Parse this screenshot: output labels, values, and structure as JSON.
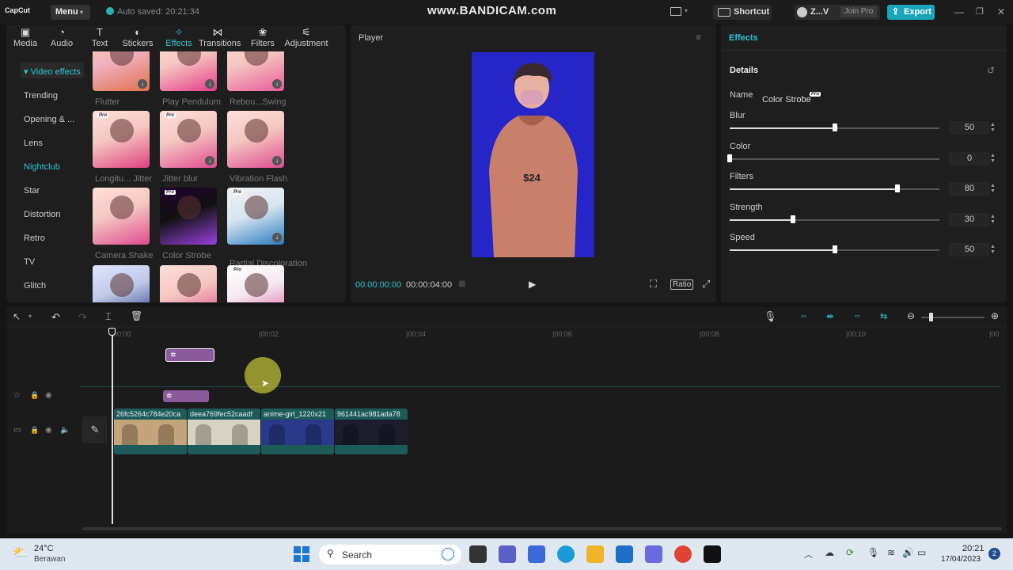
{
  "titlebar": {
    "app_name": "CapCut",
    "menu_label": "Menu",
    "autosave": "Auto saved: 20:21:34",
    "watermark": "www.BANDICAM.com",
    "shortcut_label": "Shortcut",
    "user_name": "Z...V",
    "join_pro": "Join Pro",
    "export_label": "Export"
  },
  "media_tabs": [
    {
      "label": "Media",
      "icon": "media-icon"
    },
    {
      "label": "Audio",
      "icon": "audio-icon"
    },
    {
      "label": "Text",
      "icon": "text-icon"
    },
    {
      "label": "Stickers",
      "icon": "stickers-icon"
    },
    {
      "label": "Effects",
      "icon": "effects-icon",
      "active": true
    },
    {
      "label": "Transitions",
      "icon": "transitions-icon"
    },
    {
      "label": "Filters",
      "icon": "filters-icon"
    },
    {
      "label": "Adjustment",
      "icon": "adjustment-icon"
    }
  ],
  "categories": {
    "section": "Video effects",
    "items": [
      "Trending",
      "Opening & ...",
      "Lens",
      "Nightclub",
      "Star",
      "Distortion",
      "Retro",
      "TV",
      "Glitch"
    ],
    "highlighted": "Nightclub"
  },
  "effects": [
    {
      "label": "Flutter",
      "pro": false,
      "download": true
    },
    {
      "label": "Play Pendulum",
      "pro": false,
      "download": true
    },
    {
      "label": "Rebou...Swing",
      "pro": false,
      "download": true
    },
    {
      "label": "Longitu... Jitter",
      "pro": true,
      "download": false
    },
    {
      "label": "Jitter blur",
      "pro": true,
      "download": true
    },
    {
      "label": "Vibration Flash",
      "pro": false,
      "download": true
    },
    {
      "label": "Camera Shake",
      "pro": false,
      "download": false
    },
    {
      "label": "Color Strobe",
      "pro": true,
      "download": false
    },
    {
      "label": "Partial Discoloration",
      "pro": true,
      "download": true
    },
    {
      "label": "",
      "pro": false,
      "download": false
    },
    {
      "label": "",
      "pro": false,
      "download": false
    },
    {
      "label": "",
      "pro": true,
      "download": false
    }
  ],
  "player": {
    "title": "Player",
    "current_time": "00:00:00:00",
    "total_time": "00:00:04:00",
    "ratio_label": "Ratio",
    "preview_text": "$24"
  },
  "properties": {
    "tab": "Effects",
    "section": "Details",
    "name_label": "Name",
    "name_value": "Color Strobe",
    "pro_badge": "Pro",
    "params": [
      {
        "label": "Blur",
        "value": "50",
        "fraction": 0.5
      },
      {
        "label": "Color",
        "value": "0",
        "fraction": 0.0
      },
      {
        "label": "Filters",
        "value": "80",
        "fraction": 0.8
      },
      {
        "label": "Strength",
        "value": "30",
        "fraction": 0.3
      },
      {
        "label": "Speed",
        "value": "50",
        "fraction": 0.5
      }
    ]
  },
  "timeline": {
    "ruler": [
      "00:00",
      "|00:02",
      "|00:04",
      "|00:06",
      "|00:08",
      "|00:10",
      "|00"
    ],
    "clips": [
      "26fc5264c784e20ca",
      "deea769fec52caadf",
      "anime-girl_1220x21",
      "961441ac981ada78"
    ],
    "clip_colors": [
      "#c4a47a",
      "#d8d2c2",
      "#2a3a8a",
      "#1c1c2c"
    ]
  },
  "taskbar": {
    "temperature": "24°C",
    "weather": "Berawan",
    "search_label": "Search",
    "time": "20:21",
    "date": "17/04/2023",
    "notifications": "2"
  },
  "colors": {
    "accent": "#2fc4d1",
    "export": "#18a6b8",
    "effect_clip": "#8a5a9a",
    "preview_bg": "#2626c8"
  }
}
